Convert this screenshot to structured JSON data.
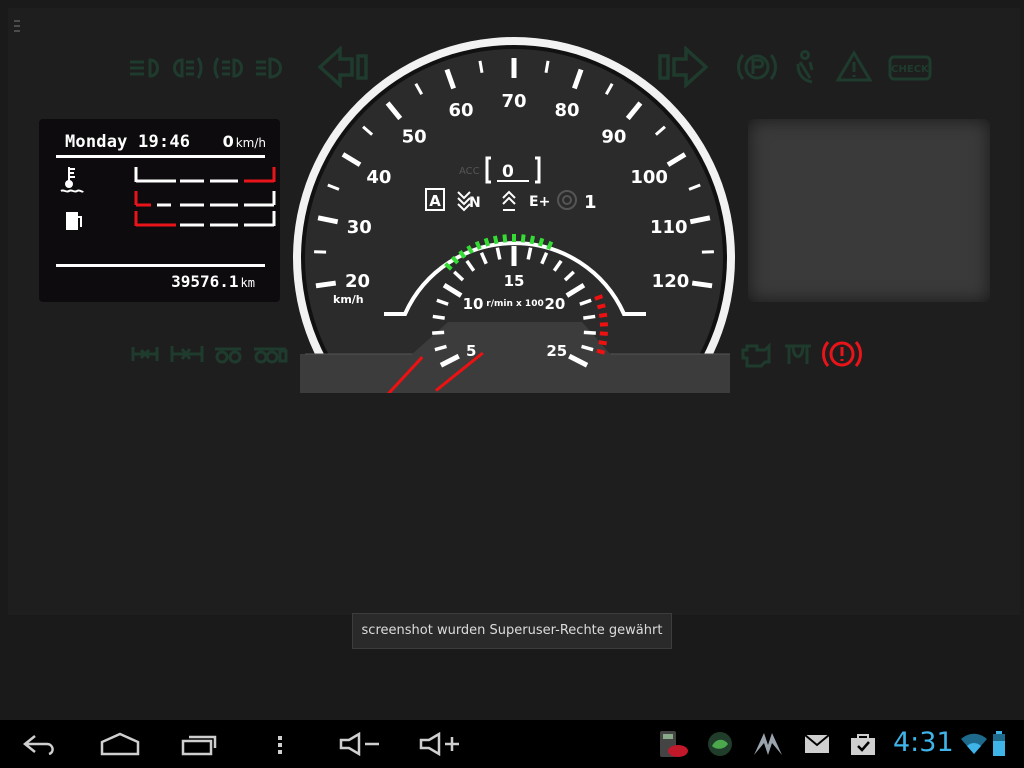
{
  "colors": {
    "accent": "#3fb4e8",
    "warning_red": "#e8141a",
    "indicator_off": "#1f3b2e",
    "gauge_face": "#2a2a2a",
    "rpm_green": "#33dd33",
    "rpm_red": "#ee1111"
  },
  "indicators": {
    "top_left": [
      "low-beam-icon",
      "fog-light-icon",
      "rear-fog-light-icon",
      "high-beam-icon",
      "turn-left-icon"
    ],
    "top_right": [
      "turn-right-icon",
      "parking-brake-icon",
      "seatbelt-icon",
      "warning-triangle-icon",
      "check-engine-icon"
    ],
    "check_label": "CHECK",
    "bottom_left": [
      "axle-lock-icon",
      "differential-lock-icon",
      "trailer-axle-icon",
      "trailer-axle-double-icon"
    ],
    "bottom_right": [
      "engine-icon",
      "glow-plug-icon",
      "brake-warning-icon"
    ],
    "brake_warning_active": true
  },
  "info": {
    "day_time": "Monday 19:46",
    "speed": "0",
    "speed_unit": "km/h",
    "odometer": "39576.1",
    "odometer_unit": "km",
    "coolant_level": 0.92,
    "fuel_level": 0.08
  },
  "gauge": {
    "speed_labels": [
      "20",
      "30",
      "40",
      "50",
      "60",
      "70",
      "80",
      "90",
      "100",
      "110",
      "120"
    ],
    "speed_unit": "km/h",
    "rpm_labels": [
      "5",
      "10",
      "15",
      "20",
      "25"
    ],
    "rpm_unit": "r/min x 100",
    "acc_label": "ACC",
    "cruise_speed": "0",
    "gear_mode": "A",
    "retarder": "N",
    "eco": "E+",
    "gear_number": "1",
    "speed_value": 0,
    "rpm_value": 4
  },
  "toast": {
    "text": "screenshot wurden Superuser-Rechte gewährt"
  },
  "system_bar": {
    "nav": [
      "back-icon",
      "home-icon",
      "recent-apps-icon",
      "menu-icon",
      "volume-down-icon",
      "volume-up-icon"
    ],
    "notifications": [
      "calculator-app-icon",
      "fishing-app-icon",
      "launcher-icon",
      "gmail-icon",
      "store-icon"
    ],
    "clock": "4:31",
    "wifi_icon": "wifi-icon",
    "battery_icon": "battery-icon"
  }
}
